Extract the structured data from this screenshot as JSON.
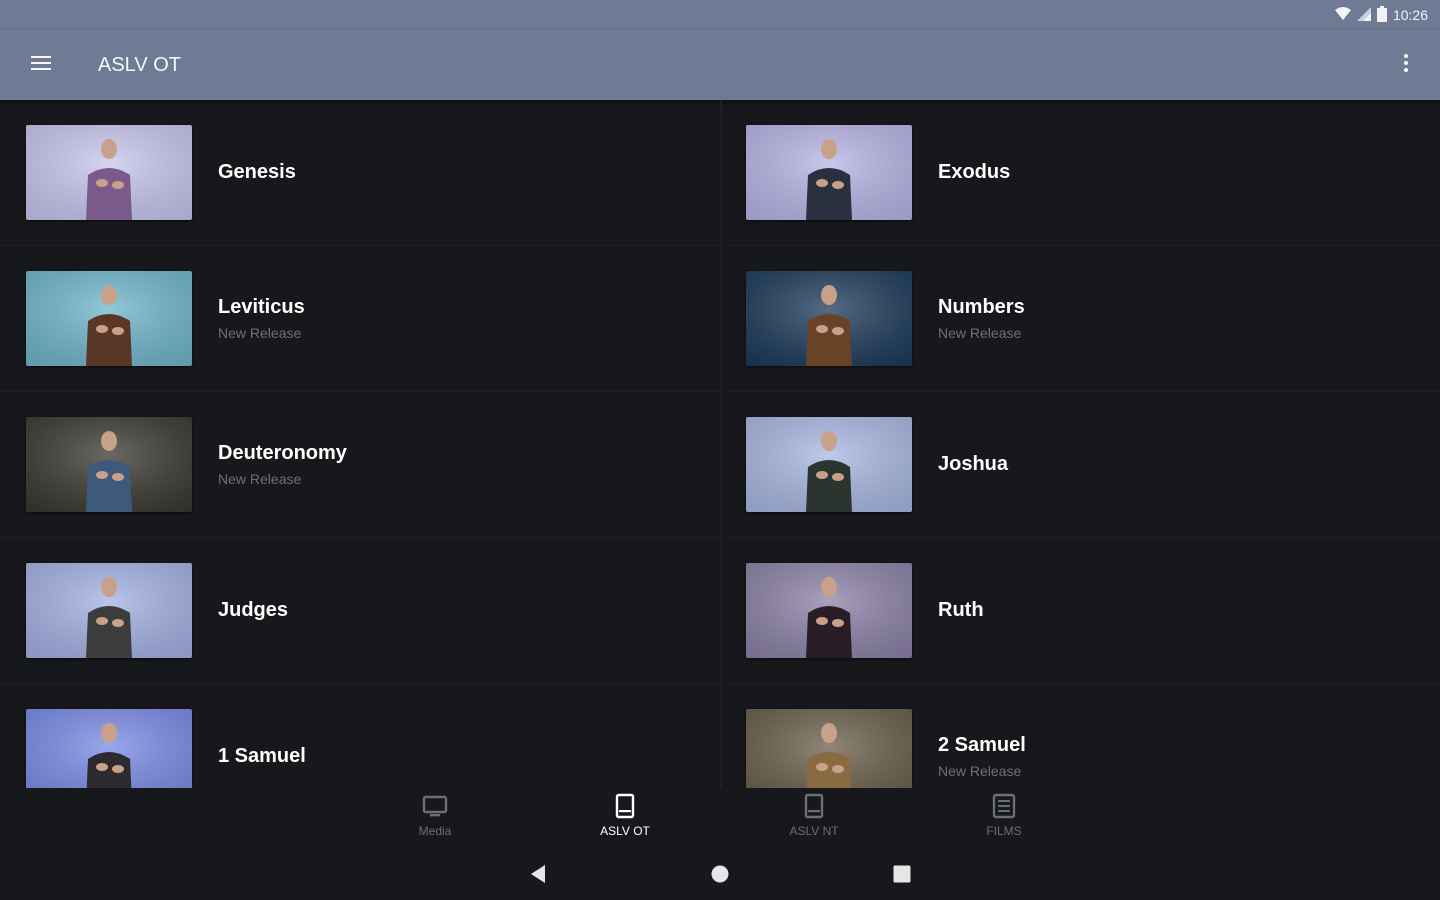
{
  "status_bar": {
    "time": "10:26"
  },
  "toolbar": {
    "title": "ASLV OT"
  },
  "books": [
    {
      "title": "Genesis",
      "subtitle": "",
      "thumb_bg": "#c8c6ee",
      "figure": "#7a5a8a"
    },
    {
      "title": "Exodus",
      "subtitle": "",
      "thumb_bg": "#b8b4e6",
      "figure": "#2a3040"
    },
    {
      "title": "Leviticus",
      "subtitle": "New Release",
      "thumb_bg": "#6fb6cc",
      "figure": "#5a3626"
    },
    {
      "title": "Numbers",
      "subtitle": "New Release",
      "thumb_bg": "#1c3a5a",
      "figure": "#6a4228"
    },
    {
      "title": "Deuteronomy",
      "subtitle": "New Release",
      "thumb_bg": "#3a3830",
      "figure": "#3e5a7a"
    },
    {
      "title": "Joshua",
      "subtitle": "",
      "thumb_bg": "#a8b8e2",
      "figure": "#2c3430"
    },
    {
      "title": "Judges",
      "subtitle": "",
      "thumb_bg": "#a4b2e4",
      "figure": "#3c3c3c"
    },
    {
      "title": "Ruth",
      "subtitle": "",
      "thumb_bg": "#8c82a8",
      "figure": "#2a1e26"
    },
    {
      "title": "1 Samuel",
      "subtitle": "",
      "thumb_bg": "#7a8ae6",
      "figure": "#2c2a2e"
    },
    {
      "title": "2 Samuel",
      "subtitle": "New Release",
      "thumb_bg": "#6a5e4a",
      "figure": "#8a6a40"
    }
  ],
  "bottom_nav": [
    {
      "label": "Media",
      "icon": "tv-icon",
      "active": false
    },
    {
      "label": "ASLV OT",
      "icon": "book-icon",
      "active": true
    },
    {
      "label": "ASLV NT",
      "icon": "book-icon",
      "active": false
    },
    {
      "label": "FILMS",
      "icon": "film-icon",
      "active": false
    }
  ],
  "colors": {
    "toolbar": "#6f7a94",
    "background": "#17181b",
    "subtitle_text": "#6d7078",
    "nav_inactive": "#6b6e76"
  }
}
